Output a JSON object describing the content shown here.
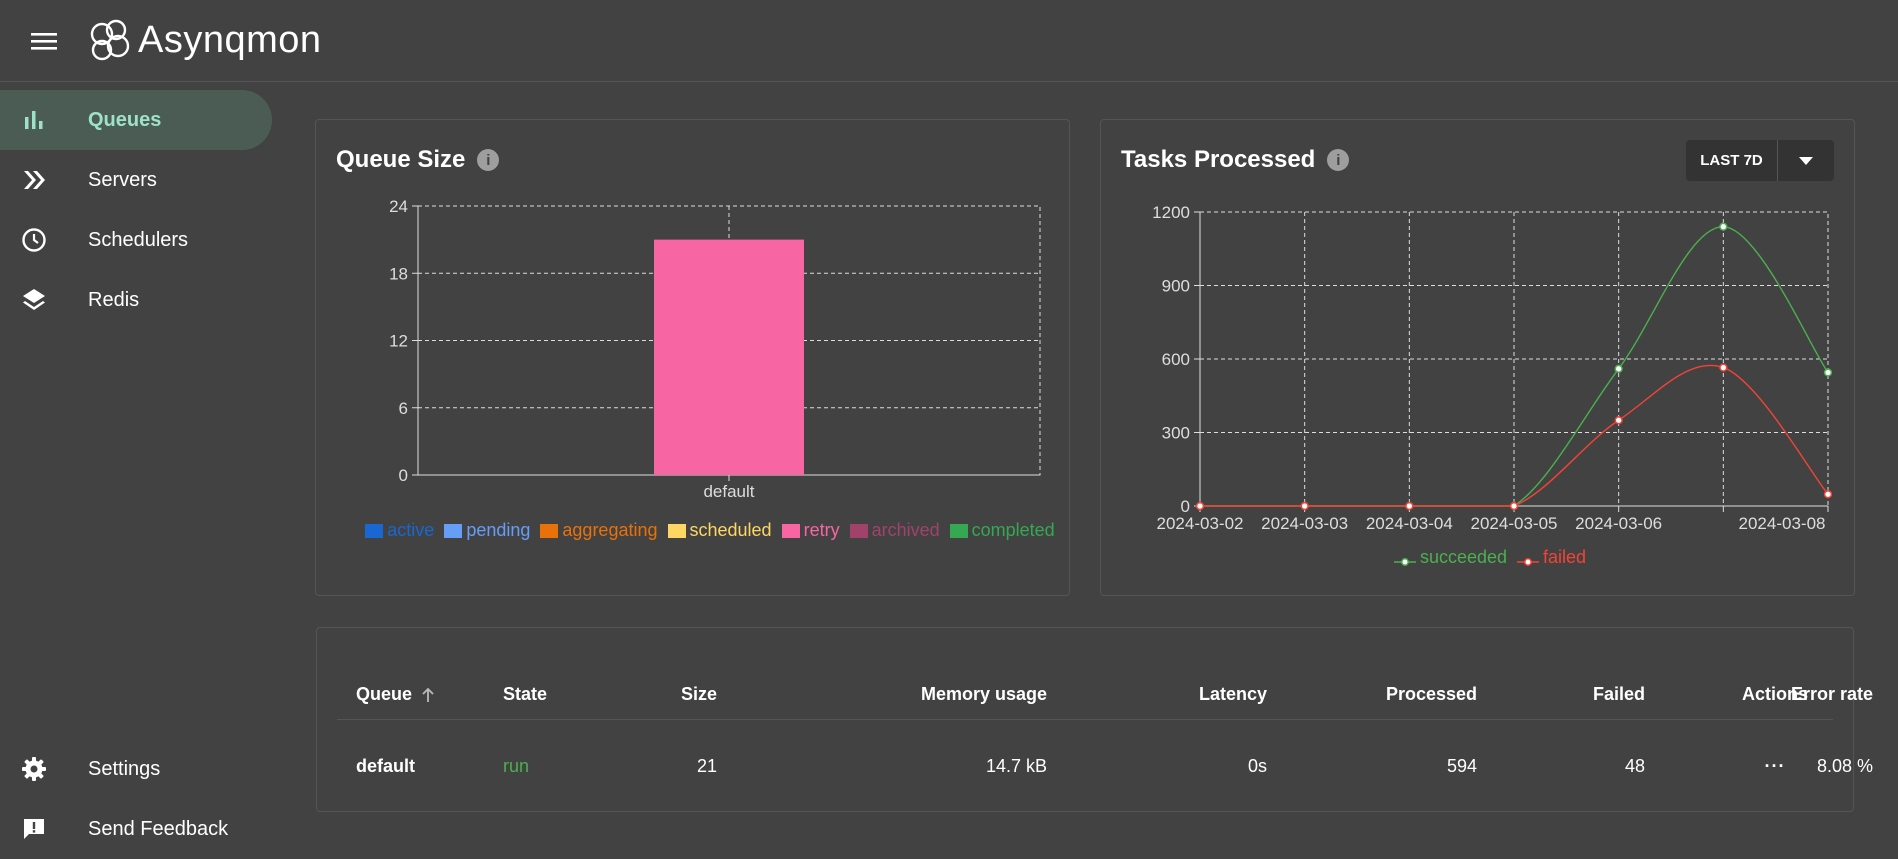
{
  "app": {
    "title": "Asynqmon"
  },
  "nav": {
    "items": [
      {
        "label": "Queues",
        "icon": "bar-chart-icon",
        "active": true
      },
      {
        "label": "Servers",
        "icon": "double-chevron-right-icon"
      },
      {
        "label": "Schedulers",
        "icon": "clock-icon"
      },
      {
        "label": "Redis",
        "icon": "layers-icon"
      }
    ],
    "bottom": [
      {
        "label": "Settings",
        "icon": "gear-icon"
      },
      {
        "label": "Send Feedback",
        "icon": "feedback-icon"
      }
    ]
  },
  "queue_size": {
    "title": "Queue Size",
    "info": "i"
  },
  "tasks_processed": {
    "title": "Tasks Processed",
    "info": "i",
    "range_label": "LAST 7D"
  },
  "colors": {
    "active": "#1967d2",
    "pending": "#669df6",
    "aggregating": "#e8710a",
    "scheduled": "#fdd663",
    "retry": "#f765a3",
    "archived": "#a1426a",
    "completed": "#34a853",
    "succeeded": "#4caf50",
    "failed": "#f44336"
  },
  "chart_data": [
    {
      "type": "bar",
      "stacked": true,
      "categories": [
        "default"
      ],
      "series": [
        {
          "name": "active",
          "values": [
            0
          ]
        },
        {
          "name": "pending",
          "values": [
            0
          ]
        },
        {
          "name": "aggregating",
          "values": [
            0
          ]
        },
        {
          "name": "scheduled",
          "values": [
            0
          ]
        },
        {
          "name": "retry",
          "values": [
            21
          ]
        },
        {
          "name": "archived",
          "values": [
            0
          ]
        },
        {
          "name": "completed",
          "values": [
            0
          ]
        }
      ],
      "yticks": [
        "0",
        "6",
        "12",
        "18",
        "24"
      ],
      "ylim": [
        0,
        24
      ],
      "grid": true,
      "legend": "bottom"
    },
    {
      "type": "line",
      "x": [
        "2024-03-02",
        "2024-03-03",
        "2024-03-04",
        "2024-03-05",
        "2024-03-06",
        "2024-03-07",
        "2024-03-08"
      ],
      "xtick_labels": [
        "2024-03-02",
        "2024-03-03",
        "2024-03-04",
        "2024-03-05",
        "2024-03-06",
        "",
        "2024-03-08"
      ],
      "series": [
        {
          "name": "succeeded",
          "values": [
            0,
            0,
            0,
            0,
            560,
            1140,
            545
          ]
        },
        {
          "name": "failed",
          "values": [
            0,
            0,
            0,
            0,
            350,
            565,
            48
          ]
        }
      ],
      "yticks": [
        "0",
        "300",
        "600",
        "900",
        "1200"
      ],
      "ylim": [
        0,
        1200
      ],
      "grid": true,
      "legend": "bottom"
    }
  ],
  "table": {
    "headers": [
      "Queue",
      "State",
      "Size",
      "Memory usage",
      "Latency",
      "Processed",
      "Failed",
      "Error rate",
      "Actions"
    ],
    "rows": [
      {
        "queue": "default",
        "state": "run",
        "size": "21",
        "memory": "14.7 kB",
        "latency": "0s",
        "processed": "594",
        "failed": "48",
        "error_rate": "8.08 %",
        "actions": "···"
      }
    ]
  }
}
